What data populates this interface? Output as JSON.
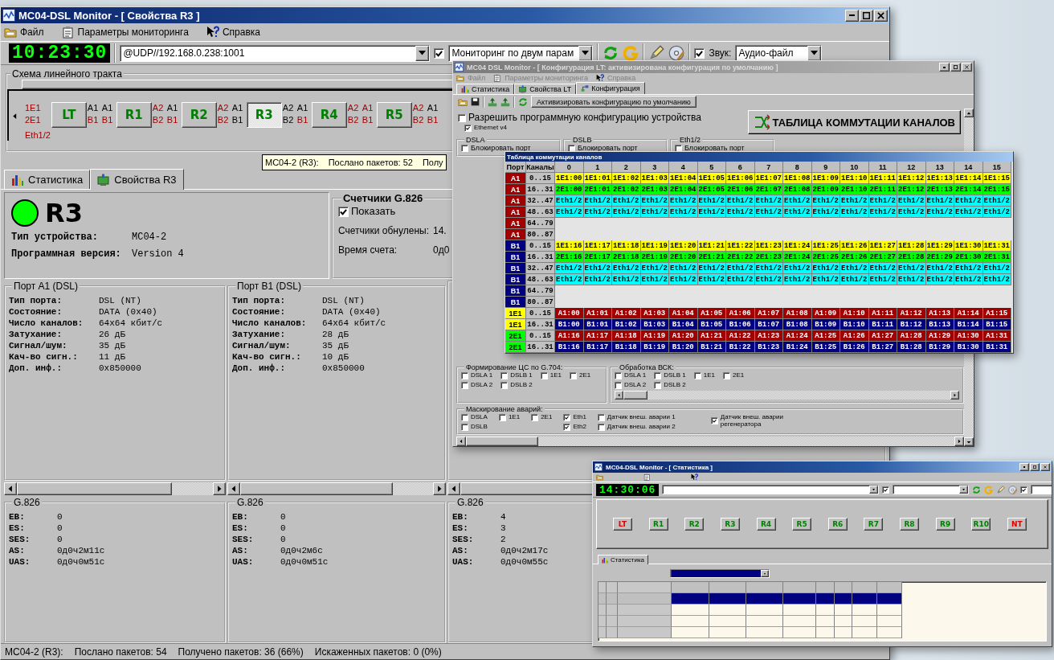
{
  "main_window": {
    "title": "МС04-DSL Monitor - [ Свойства R3 ]",
    "menu": [
      "Файл",
      "Параметры мониторинга",
      "Справка"
    ],
    "toolbar": {
      "clock": "10:23:30",
      "address": "@UDP//192.168.0.238:1001",
      "monitoring_checked": true,
      "mode": "Мониторинг по двум парам",
      "sound_checked": true,
      "sound_label": "Звук:",
      "sound_value": "Аудио-файл"
    },
    "schema": {
      "title": "Схема линейного тракта",
      "items": [
        {
          "kind": "ports",
          "labels": [
            {
              "text": "1E1",
              "alarm": true
            },
            {
              "text": "2E1",
              "alarm": true
            }
          ],
          "note": "Eth1/2"
        },
        {
          "kind": "node",
          "label": "LT",
          "selected": false
        },
        {
          "kind": "ports",
          "labels": [
            {
              "text": "A1",
              "alarm": false
            },
            {
              "text": "B1",
              "alarm": true
            }
          ]
        },
        {
          "kind": "ports",
          "labels": [
            {
              "text": "A1",
              "alarm": false
            },
            {
              "text": "B1",
              "alarm": true
            }
          ]
        },
        {
          "kind": "node",
          "label": "R1",
          "selected": false
        },
        {
          "kind": "ports",
          "labels": [
            {
              "text": "A2",
              "alarm": true
            },
            {
              "text": "B2",
              "alarm": true
            }
          ]
        },
        {
          "kind": "ports",
          "labels": [
            {
              "text": "A1",
              "alarm": false
            },
            {
              "text": "B1",
              "alarm": true
            }
          ]
        },
        {
          "kind": "node",
          "label": "R2",
          "selected": false
        },
        {
          "kind": "ports",
          "labels": [
            {
              "text": "A2",
              "alarm": true
            },
            {
              "text": "B2",
              "alarm": true
            }
          ]
        },
        {
          "kind": "ports",
          "labels": [
            {
              "text": "A1",
              "alarm": false
            },
            {
              "text": "B1",
              "alarm": false
            }
          ]
        },
        {
          "kind": "node",
          "label": "R3",
          "selected": true
        },
        {
          "kind": "ports",
          "labels": [
            {
              "text": "A2",
              "alarm": false
            },
            {
              "text": "B2",
              "alarm": false
            }
          ]
        },
        {
          "kind": "ports",
          "labels": [
            {
              "text": "A1",
              "alarm": false
            },
            {
              "text": "B1",
              "alarm": true
            }
          ]
        },
        {
          "kind": "node",
          "label": "R4",
          "selected": false
        },
        {
          "kind": "ports",
          "labels": [
            {
              "text": "A2",
              "alarm": true
            },
            {
              "text": "B2",
              "alarm": true
            }
          ]
        },
        {
          "kind": "ports",
          "labels": [
            {
              "text": "A1",
              "alarm": true
            },
            {
              "text": "B1",
              "alarm": true
            }
          ]
        },
        {
          "kind": "node",
          "label": "R5",
          "selected": false
        },
        {
          "kind": "ports",
          "labels": [
            {
              "text": "A2",
              "alarm": true
            },
            {
              "text": "B2",
              "alarm": true
            }
          ]
        },
        {
          "kind": "ports",
          "labels": [
            {
              "text": "A1",
              "alarm": false
            },
            {
              "text": "B1",
              "alarm": true
            }
          ]
        }
      ]
    },
    "tooltip": [
      "МС04-2 (R3):",
      "Послано пакетов: 52",
      "Полу"
    ],
    "tabs": [
      {
        "label": "Статистика",
        "selected": false
      },
      {
        "label": "Свойства R3",
        "selected": true
      }
    ],
    "device": {
      "status_dot": {
        "color": "#00ff00"
      },
      "name": "R3",
      "fields": [
        {
          "label": "Тип устройства:",
          "value": "МС04-2"
        },
        {
          "label": "Программная версия:",
          "value": "Version 4"
        }
      ]
    },
    "counters": {
      "title": "Счетчики G.826",
      "show_label": "Показать",
      "show_checked": true,
      "fields": [
        {
          "label": "Счетчики обнулены:",
          "value": "14."
        },
        {
          "label": "Время счета:",
          "value": "0д0"
        }
      ]
    },
    "ports": [
      {
        "title": "Порт A1 (DSL)",
        "fields": [
          {
            "label": "Тип порта:",
            "value": "DSL (NT)"
          },
          {
            "label": "Состояние:",
            "value": "DATA (0x40)"
          },
          {
            "label": "Число каналов:",
            "value": "64x64 кбит/с"
          },
          {
            "label": "Затухание:",
            "value": "26 дБ"
          },
          {
            "label": "Сигнал/шум:",
            "value": "35 дБ"
          },
          {
            "label": "Кач-во сигн.:",
            "value": "11 дБ"
          },
          {
            "label": "Доп. инф.:",
            "value": "0x850000"
          }
        ]
      },
      {
        "title": "Порт B1 (DSL)",
        "fields": [
          {
            "label": "Тип порта:",
            "value": "DSL (NT)"
          },
          {
            "label": "Состояние:",
            "value": "DATA (0x40)"
          },
          {
            "label": "Число каналов:",
            "value": "64x64 кбит/с"
          },
          {
            "label": "Затухание:",
            "value": "28 дБ"
          },
          {
            "label": "Сигнал/шум:",
            "value": "35 дБ"
          },
          {
            "label": "Кач-во сигн.:",
            "value": "10 дБ"
          },
          {
            "label": "Доп. инф.:",
            "value": "0x850000"
          }
        ]
      }
    ],
    "g826": [
      {
        "title": "G.826",
        "fields": [
          {
            "label": "EB:",
            "value": "0"
          },
          {
            "label": "ES:",
            "value": "0"
          },
          {
            "label": "SES:",
            "value": "0"
          },
          {
            "label": "AS:",
            "value": "0д0ч2м11с"
          },
          {
            "label": "UAS:",
            "value": "0д0ч0м51с"
          }
        ]
      },
      {
        "title": "G.826",
        "fields": [
          {
            "label": "EB:",
            "value": "0"
          },
          {
            "label": "ES:",
            "value": "0"
          },
          {
            "label": "SES:",
            "value": "0"
          },
          {
            "label": "AS:",
            "value": "0д0ч2м6с"
          },
          {
            "label": "UAS:",
            "value": "0д0ч0м51с"
          }
        ]
      },
      {
        "title": "G.826",
        "fields": [
          {
            "label": "EB:",
            "value": "4"
          },
          {
            "label": "ES:",
            "value": "3"
          },
          {
            "label": "SES:",
            "value": "2"
          },
          {
            "label": "AS:",
            "value": "0д0ч2м17с"
          },
          {
            "label": "UAS:",
            "value": "0д0ч0м55с"
          }
        ]
      }
    ],
    "status_bar": [
      "МС04-2 (R3):",
      "Послано пакетов: 54",
      "Получено пакетов: 36 (66%)",
      "Искаженных пакетов: 0 (0%)"
    ]
  },
  "config_window": {
    "title": "МС04 DSL Monitor - [ Конфигурация LT: активизирована конфигурация по умолчанию ]",
    "menu": [
      "Файл",
      "Параметры мониторинга",
      "Справка"
    ],
    "tabs": [
      {
        "label": "Статистика",
        "selected": false
      },
      {
        "label": "Свойства LT",
        "selected": false
      },
      {
        "label": "Конфигурация",
        "selected": true
      }
    ],
    "activate_button": "Активизировать конфигурацию по умолчанию",
    "allow": {
      "label": "Разрешить программную конфигурацию устройства",
      "checked": false
    },
    "ethernet": {
      "label": "Ethernet v4",
      "checked": true
    },
    "table_button": "ТАБЛИЦА КОММУТАЦИИ КАНАЛОВ",
    "port_groups": [
      {
        "title": "DSLA",
        "label": "Блокировать порт",
        "checked": false
      },
      {
        "title": "DSLB",
        "label": "Блокировать порт",
        "checked": false
      },
      {
        "title": "Eth1/2",
        "label": "Блокировать порт",
        "checked": false
      }
    ],
    "sections": [
      {
        "title": "Формирование ЦС по G.704:",
        "options": [
          {
            "label": "DSLA 1",
            "checked": false
          },
          {
            "label": "DSLB 1",
            "checked": false
          },
          {
            "label": "1E1",
            "checked": false
          },
          {
            "label": "2E1",
            "checked": false
          },
          {
            "label": "DSLA 2",
            "checked": false
          },
          {
            "label": "DSLB 2",
            "checked": false
          }
        ]
      },
      {
        "title": "Обработка ВСК:",
        "options": [
          {
            "label": "DSLA 1",
            "checked": false
          },
          {
            "label": "DSLB 1",
            "checked": false
          },
          {
            "label": "1E1",
            "checked": false
          },
          {
            "label": "2E1",
            "checked": false
          },
          {
            "label": "DSLA 2",
            "checked": false
          },
          {
            "label": "DSLB 2",
            "checked": false
          }
        ]
      }
    ],
    "alarm_mask": {
      "title": "Маскирование аварий:",
      "columns": [
        [
          {
            "label": "DSLA",
            "checked": false
          },
          {
            "label": "DSLB",
            "checked": false
          }
        ],
        [
          {
            "label": "1E1",
            "checked": false
          }
        ],
        [
          {
            "label": "2E1",
            "checked": false
          }
        ],
        [
          {
            "label": "Eth1",
            "checked": true
          },
          {
            "label": "Eth2",
            "checked": true
          }
        ],
        [
          {
            "label": "Датчик внеш. аварии 1",
            "checked": false
          },
          {
            "label": "Датчик внеш. аварии 2",
            "checked": false
          }
        ],
        [
          {
            "label": "Датчик внеш. аварии регенератора",
            "checked": true
          }
        ]
      ]
    }
  },
  "channel_table": {
    "title": "Таблица коммутации каналов",
    "headers": [
      "Порт",
      "Каналы",
      "0",
      "1",
      "2",
      "3",
      "4",
      "5",
      "6",
      "7",
      "8",
      "9",
      "10",
      "11",
      "12",
      "13",
      "14",
      "15"
    ],
    "rows": [
      {
        "port": {
          "text": "A1",
          "color": "#a00000"
        },
        "channels": "0..15",
        "color": "#ffff00",
        "cells": [
          "1E1:00",
          "1E1:01",
          "1E1:02",
          "1E1:03",
          "1E1:04",
          "1E1:05",
          "1E1:06",
          "1E1:07",
          "1E1:08",
          "1E1:09",
          "1E1:10",
          "1E1:11",
          "1E1:12",
          "1E1:13",
          "1E1:14",
          "1E1:15"
        ]
      },
      {
        "port": {
          "text": "A1",
          "color": "#a00000"
        },
        "channels": "16..31",
        "color": "#00ff00",
        "cells": [
          "2E1:00",
          "2E1:01",
          "2E1:02",
          "2E1:03",
          "2E1:04",
          "2E1:05",
          "2E1:06",
          "2E1:07",
          "2E1:08",
          "2E1:09",
          "2E1:10",
          "2E1:11",
          "2E1:12",
          "2E1:13",
          "2E1:14",
          "2E1:15"
        ]
      },
      {
        "port": {
          "text": "A1",
          "color": "#a00000"
        },
        "channels": "32..47",
        "color": "#00ffff",
        "cells": [
          "Eth1/2",
          "Eth1/2",
          "Eth1/2",
          "Eth1/2",
          "Eth1/2",
          "Eth1/2",
          "Eth1/2",
          "Eth1/2",
          "Eth1/2",
          "Eth1/2",
          "Eth1/2",
          "Eth1/2",
          "Eth1/2",
          "Eth1/2",
          "Eth1/2",
          "Eth1/2"
        ]
      },
      {
        "port": {
          "text": "A1",
          "color": "#a00000"
        },
        "channels": "48..63",
        "color": "#00ffff",
        "cells": [
          "Eth1/2",
          "Eth1/2",
          "Eth1/2",
          "Eth1/2",
          "Eth1/2",
          "Eth1/2",
          "Eth1/2",
          "Eth1/2",
          "Eth1/2",
          "Eth1/2",
          "Eth1/2",
          "Eth1/2",
          "Eth1/2",
          "Eth1/2",
          "Eth1/2",
          "Eth1/2"
        ]
      },
      {
        "port": {
          "text": "A1",
          "color": "#a00000"
        },
        "channels": "64..79"
      },
      {
        "port": {
          "text": "A1",
          "color": "#a00000"
        },
        "channels": "80..87"
      },
      {
        "port": {
          "text": "B1",
          "color": "#000080"
        },
        "channels": "0..15",
        "color": "#ffff00",
        "cells": [
          "1E1:16",
          "1E1:17",
          "1E1:18",
          "1E1:19",
          "1E1:20",
          "1E1:21",
          "1E1:22",
          "1E1:23",
          "1E1:24",
          "1E1:25",
          "1E1:26",
          "1E1:27",
          "1E1:28",
          "1E1:29",
          "1E1:30",
          "1E1:31"
        ]
      },
      {
        "port": {
          "text": "B1",
          "color": "#000080"
        },
        "channels": "16..31",
        "color": "#00ff00",
        "cells": [
          "2E1:16",
          "2E1:17",
          "2E1:18",
          "2E1:19",
          "2E1:20",
          "2E1:21",
          "2E1:22",
          "2E1:23",
          "2E1:24",
          "2E1:25",
          "2E1:26",
          "2E1:27",
          "2E1:28",
          "2E1:29",
          "2E1:30",
          "2E1:31"
        ]
      },
      {
        "port": {
          "text": "B1",
          "color": "#000080"
        },
        "channels": "32..47",
        "color": "#00ffff",
        "cells": [
          "Eth1/2",
          "Eth1/2",
          "Eth1/2",
          "Eth1/2",
          "Eth1/2",
          "Eth1/2",
          "Eth1/2",
          "Eth1/2",
          "Eth1/2",
          "Eth1/2",
          "Eth1/2",
          "Eth1/2",
          "Eth1/2",
          "Eth1/2",
          "Eth1/2",
          "Eth1/2"
        ]
      },
      {
        "port": {
          "text": "B1",
          "color": "#000080"
        },
        "channels": "48..63",
        "color": "#00ffff",
        "cells": [
          "Eth1/2",
          "Eth1/2",
          "Eth1/2",
          "Eth1/2",
          "Eth1/2",
          "Eth1/2",
          "Eth1/2",
          "Eth1/2",
          "Eth1/2",
          "Eth1/2",
          "Eth1/2",
          "Eth1/2",
          "Eth1/2",
          "Eth1/2",
          "Eth1/2",
          "Eth1/2"
        ]
      },
      {
        "port": {
          "text": "B1",
          "color": "#000080"
        },
        "channels": "64..79"
      },
      {
        "port": {
          "text": "B1",
          "color": "#000080"
        },
        "channels": "80..87"
      },
      {
        "port": {
          "text": "1E1",
          "color": "#ffff00"
        },
        "channels": "0..15",
        "color": "#a00000",
        "cells": [
          "A1:00",
          "A1:01",
          "A1:02",
          "A1:03",
          "A1:04",
          "A1:05",
          "A1:06",
          "A1:07",
          "A1:08",
          "A1:09",
          "A1:10",
          "A1:11",
          "A1:12",
          "A1:13",
          "A1:14",
          "A1:15"
        ]
      },
      {
        "port": {
          "text": "1E1",
          "color": "#ffff00"
        },
        "channels": "16..31",
        "color": "#000080",
        "cells": [
          "B1:00",
          "B1:01",
          "B1:02",
          "B1:03",
          "B1:04",
          "B1:05",
          "B1:06",
          "B1:07",
          "B1:08",
          "B1:09",
          "B1:10",
          "B1:11",
          "B1:12",
          "B1:13",
          "B1:14",
          "B1:15"
        ]
      },
      {
        "port": {
          "text": "2E1",
          "color": "#00ff00"
        },
        "channels": "0..15",
        "color": "#a00000",
        "cells": [
          "A1:16",
          "A1:17",
          "A1:18",
          "A1:19",
          "A1:20",
          "A1:21",
          "A1:22",
          "A1:23",
          "A1:24",
          "A1:25",
          "A1:26",
          "A1:27",
          "A1:28",
          "A1:29",
          "A1:30",
          "A1:31"
        ]
      },
      {
        "port": {
          "text": "2E1",
          "color": "#00ff00"
        },
        "channels": "16..31",
        "color": "#000080",
        "cells": [
          "B1:16",
          "B1:17",
          "B1:18",
          "B1:19",
          "B1:20",
          "B1:21",
          "B1:22",
          "B1:23",
          "B1:24",
          "B1:25",
          "B1:26",
          "B1:27",
          "B1:28",
          "B1:29",
          "B1:30",
          "B1:31"
        ]
      }
    ]
  },
  "stats_window": {
    "title": "MC04-DSL Monitor - [ Статистика ]",
    "clock": "14:30:06",
    "monitoring_checked": true,
    "sound_checked": true,
    "nodes": [
      {
        "label": "LT",
        "alarm": true
      },
      {
        "label": "R1",
        "alarm": false
      },
      {
        "label": "R2",
        "alarm": false
      },
      {
        "label": "R3",
        "alarm": false
      },
      {
        "label": "R4",
        "alarm": false
      },
      {
        "label": "R5",
        "alarm": false
      },
      {
        "label": "R6",
        "alarm": false
      },
      {
        "label": "R7",
        "alarm": false
      },
      {
        "label": "R8",
        "alarm": false
      },
      {
        "label": "R9",
        "alarm": false
      },
      {
        "label": "R10",
        "alarm": false
      },
      {
        "label": "NT",
        "alarm": true
      }
    ],
    "tabs": [
      {
        "label": "Статистика",
        "selected": true
      }
    ],
    "rows": [
      {
        "selected": true
      },
      {
        "selected": false
      },
      {
        "selected": false
      },
      {
        "selected": false
      }
    ]
  }
}
